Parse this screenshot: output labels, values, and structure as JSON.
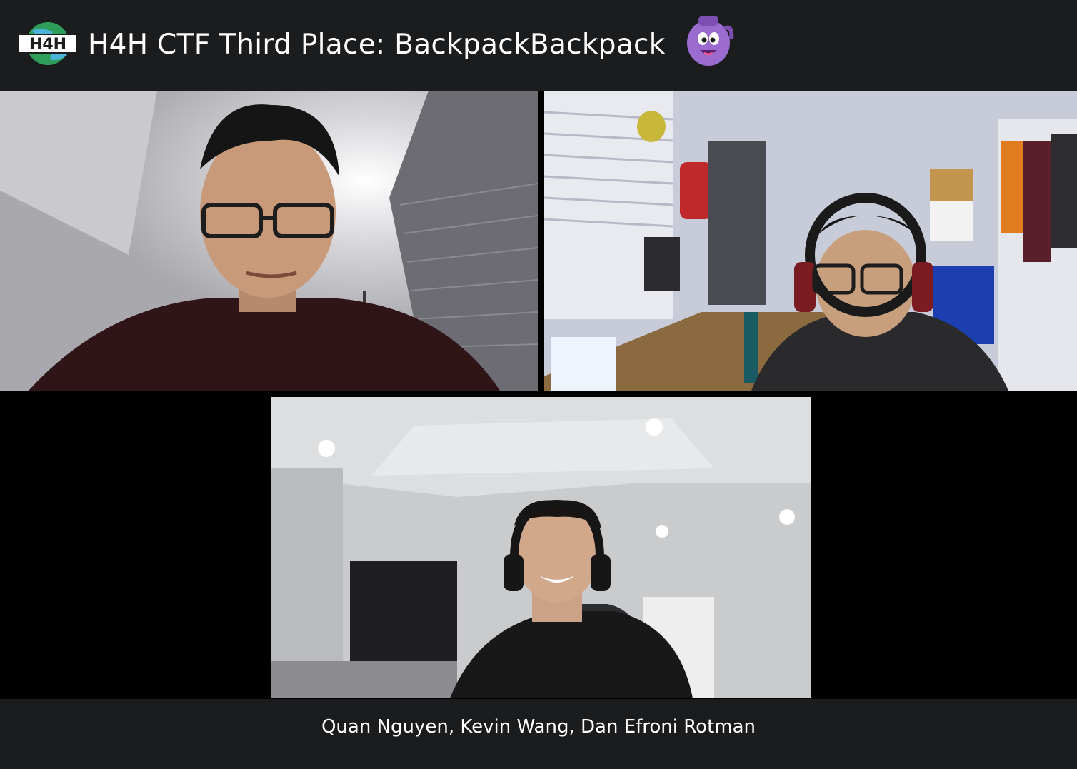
{
  "header": {
    "logo_text": "H4H",
    "title": "H4H CTF Third Place: BackpackBackpack",
    "logo_icon": "h4h-globe-logo",
    "mascot_icon": "purple-backpack-mascot-icon"
  },
  "participants": [
    {
      "tile": "video-tile-1",
      "description_icon": "person-video-feed"
    },
    {
      "tile": "video-tile-2",
      "description_icon": "person-with-headset-video-feed"
    },
    {
      "tile": "video-tile-3",
      "description_icon": "person-with-headset-video-feed"
    }
  ],
  "footer": {
    "names": "Quan Nguyen, Kevin Wang, Dan Efroni Rotman"
  },
  "colors": {
    "bar_background": "#1b1c1e",
    "gallery_background": "#000000",
    "text": "#ffffff",
    "mascot_purple": "#9b6bd0",
    "logo_green": "#2e9e5a"
  }
}
